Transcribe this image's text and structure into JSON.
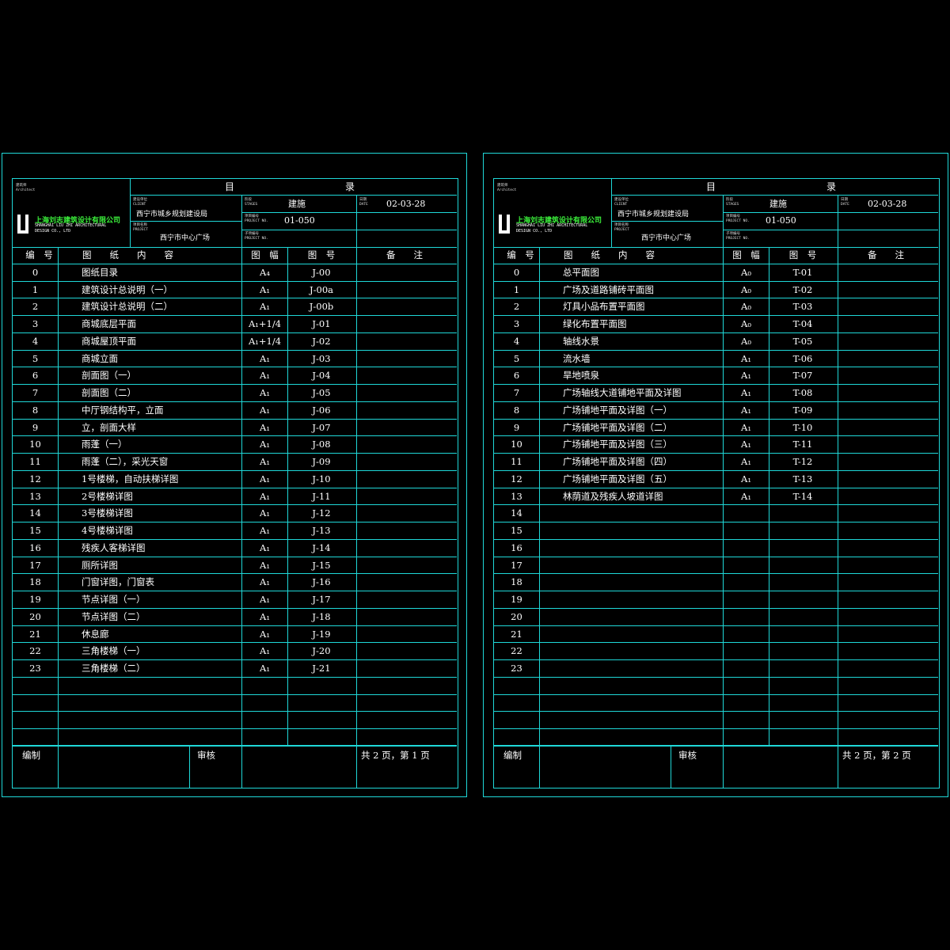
{
  "colors": {
    "frame_line": "#1fd8d8",
    "text": "#ffffff",
    "logo_text": "#3bf03b",
    "background": "#000000"
  },
  "sheets": [
    {
      "architect_cn": "建筑师",
      "architect_en": "Architect",
      "company_cn": "上海刘志建筑设计有限公司",
      "company_en_1": "SHANGHAI LIU ZHI ARCHITECTURAL",
      "company_en_2": "DESIGN CO., LTD",
      "title_left": "目",
      "title_right": "录",
      "client_label_cn": "建设单位",
      "client_label_en": "CLIENT",
      "client": "西宁市城乡规划建设局",
      "project_label_cn": "项目名称",
      "project_label_en": "PROJECT",
      "project": "西宁市中心广场",
      "stage_label_cn": "阶段",
      "stage_label_en": "STAGES",
      "stage": "建施",
      "projno_label_cn": "项目编号",
      "projno_label_en": "PROJECT NO.",
      "projno": "01-050",
      "subno_label_cn": "子项编号",
      "subno_label_en": "PROJECT NO.",
      "date_label_cn": "日期",
      "date_label_en": "DATE",
      "date": "02-03-28",
      "col_no": "编　号",
      "col_name": "图　　纸　　内　　容",
      "col_size": "图　幅",
      "col_num": "图　号",
      "col_note": "备　　注",
      "rows": [
        {
          "no": "0",
          "name": "图纸目录",
          "size": "A₄",
          "num": "J-00"
        },
        {
          "no": "1",
          "name": "建筑设计总说明（一）",
          "size": "A₁",
          "num": "J-00a"
        },
        {
          "no": "2",
          "name": "建筑设计总说明（二）",
          "size": "A₁",
          "num": "J-00b"
        },
        {
          "no": "3",
          "name": "商城底层平面",
          "size": "A₁+1/4",
          "num": "J-01"
        },
        {
          "no": "4",
          "name": "商城屋顶平面",
          "size": "A₁+1/4",
          "num": "J-02"
        },
        {
          "no": "5",
          "name": "商城立面",
          "size": "A₁",
          "num": "J-03"
        },
        {
          "no": "6",
          "name": "剖面图（一）",
          "size": "A₁",
          "num": "J-04"
        },
        {
          "no": "7",
          "name": "剖面图（二）",
          "size": "A₁",
          "num": "J-05"
        },
        {
          "no": "8",
          "name": "中厅钢结构平，立面",
          "size": "A₁",
          "num": "J-06"
        },
        {
          "no": "9",
          "name": "立，剖面大样",
          "size": "A₁",
          "num": "J-07"
        },
        {
          "no": "10",
          "name": "雨蓬（一）",
          "size": "A₁",
          "num": "J-08"
        },
        {
          "no": "11",
          "name": "雨蓬（二），采光天窗",
          "size": "A₁",
          "num": "J-09"
        },
        {
          "no": "12",
          "name": "1号楼梯，自动扶梯详图",
          "size": "A₁",
          "num": "J-10"
        },
        {
          "no": "13",
          "name": "2号楼梯详图",
          "size": "A₁",
          "num": "J-11"
        },
        {
          "no": "14",
          "name": "3号楼梯详图",
          "size": "A₁",
          "num": "J-12"
        },
        {
          "no": "15",
          "name": "4号楼梯详图",
          "size": "A₁",
          "num": "J-13"
        },
        {
          "no": "16",
          "name": "残疾人客梯详图",
          "size": "A₁",
          "num": "J-14"
        },
        {
          "no": "17",
          "name": "厕所详图",
          "size": "A₁",
          "num": "J-15"
        },
        {
          "no": "18",
          "name": "门窗详图，门窗表",
          "size": "A₁",
          "num": "J-16"
        },
        {
          "no": "19",
          "name": "节点详图（一）",
          "size": "A₁",
          "num": "J-17"
        },
        {
          "no": "20",
          "name": "节点详图（二）",
          "size": "A₁",
          "num": "J-18"
        },
        {
          "no": "21",
          "name": "休息廊",
          "size": "A₁",
          "num": "J-19"
        },
        {
          "no": "22",
          "name": "三角楼梯（一）",
          "size": "A₁",
          "num": "J-20"
        },
        {
          "no": "23",
          "name": "三角楼梯（二）",
          "size": "A₁",
          "num": "J-21"
        },
        {
          "no": "",
          "name": "",
          "size": "",
          "num": ""
        },
        {
          "no": "",
          "name": "",
          "size": "",
          "num": ""
        },
        {
          "no": "",
          "name": "",
          "size": "",
          "num": ""
        },
        {
          "no": "",
          "name": "",
          "size": "",
          "num": ""
        }
      ],
      "footer_compile": "编制",
      "footer_review": "审核",
      "footer_pages": "共 2 页，第 1 页"
    },
    {
      "architect_cn": "建筑师",
      "architect_en": "Architect",
      "company_cn": "上海刘志建筑设计有限公司",
      "company_en_1": "SHANGHAI LIU ZHI ARCHITECTURAL",
      "company_en_2": "DESIGN CO., LTD",
      "title_left": "目",
      "title_right": "录",
      "client_label_cn": "建设单位",
      "client_label_en": "CLIENT",
      "client": "西宁市城乡规划建设局",
      "project_label_cn": "项目名称",
      "project_label_en": "PROJECT",
      "project": "西宁市中心广场",
      "stage_label_cn": "阶段",
      "stage_label_en": "STAGES",
      "stage": "建施",
      "projno_label_cn": "项目编号",
      "projno_label_en": "PROJECT NO.",
      "projno": "01-050",
      "subno_label_cn": "子项编号",
      "subno_label_en": "PROJECT NO.",
      "date_label_cn": "日期",
      "date_label_en": "DATE",
      "date": "02-03-28",
      "col_no": "编　号",
      "col_name": "图　　纸　　内　　容",
      "col_size": "图　幅",
      "col_num": "图　号",
      "col_note": "备　　注",
      "rows": [
        {
          "no": "0",
          "name": "总平面图",
          "size": "A₀",
          "num": "T-01"
        },
        {
          "no": "1",
          "name": "广场及道路铺砖平面图",
          "size": "A₀",
          "num": "T-02"
        },
        {
          "no": "2",
          "name": "灯具小品布置平面图",
          "size": "A₀",
          "num": "T-03"
        },
        {
          "no": "3",
          "name": "绿化布置平面图",
          "size": "A₀",
          "num": "T-04"
        },
        {
          "no": "4",
          "name": "轴线水景",
          "size": "A₀",
          "num": "T-05"
        },
        {
          "no": "5",
          "name": "流水墙",
          "size": "A₁",
          "num": "T-06"
        },
        {
          "no": "6",
          "name": "旱地喷泉",
          "size": "A₁",
          "num": "T-07"
        },
        {
          "no": "7",
          "name": "广场轴线大道铺地平面及详图",
          "size": "A₁",
          "num": "T-08"
        },
        {
          "no": "8",
          "name": "广场铺地平面及详图（一）",
          "size": "A₁",
          "num": "T-09"
        },
        {
          "no": "9",
          "name": "广场铺地平面及详图（二）",
          "size": "A₁",
          "num": "T-10"
        },
        {
          "no": "10",
          "name": "广场铺地平面及详图（三）",
          "size": "A₁",
          "num": "T-11"
        },
        {
          "no": "11",
          "name": "广场铺地平面及详图（四）",
          "size": "A₁",
          "num": "T-12"
        },
        {
          "no": "12",
          "name": "广场铺地平面及详图（五）",
          "size": "A₁",
          "num": "T-13"
        },
        {
          "no": "13",
          "name": "林荫道及残疾人坡道详图",
          "size": "A₁",
          "num": "T-14"
        },
        {
          "no": "14",
          "name": "",
          "size": "",
          "num": ""
        },
        {
          "no": "15",
          "name": "",
          "size": "",
          "num": ""
        },
        {
          "no": "16",
          "name": "",
          "size": "",
          "num": ""
        },
        {
          "no": "17",
          "name": "",
          "size": "",
          "num": ""
        },
        {
          "no": "18",
          "name": "",
          "size": "",
          "num": ""
        },
        {
          "no": "19",
          "name": "",
          "size": "",
          "num": ""
        },
        {
          "no": "20",
          "name": "",
          "size": "",
          "num": ""
        },
        {
          "no": "21",
          "name": "",
          "size": "",
          "num": ""
        },
        {
          "no": "22",
          "name": "",
          "size": "",
          "num": ""
        },
        {
          "no": "23",
          "name": "",
          "size": "",
          "num": ""
        },
        {
          "no": "",
          "name": "",
          "size": "",
          "num": ""
        },
        {
          "no": "",
          "name": "",
          "size": "",
          "num": ""
        },
        {
          "no": "",
          "name": "",
          "size": "",
          "num": ""
        },
        {
          "no": "",
          "name": "",
          "size": "",
          "num": ""
        }
      ],
      "footer_compile": "编制",
      "footer_review": "审核",
      "footer_pages": "共 2 页，第 2 页"
    }
  ]
}
